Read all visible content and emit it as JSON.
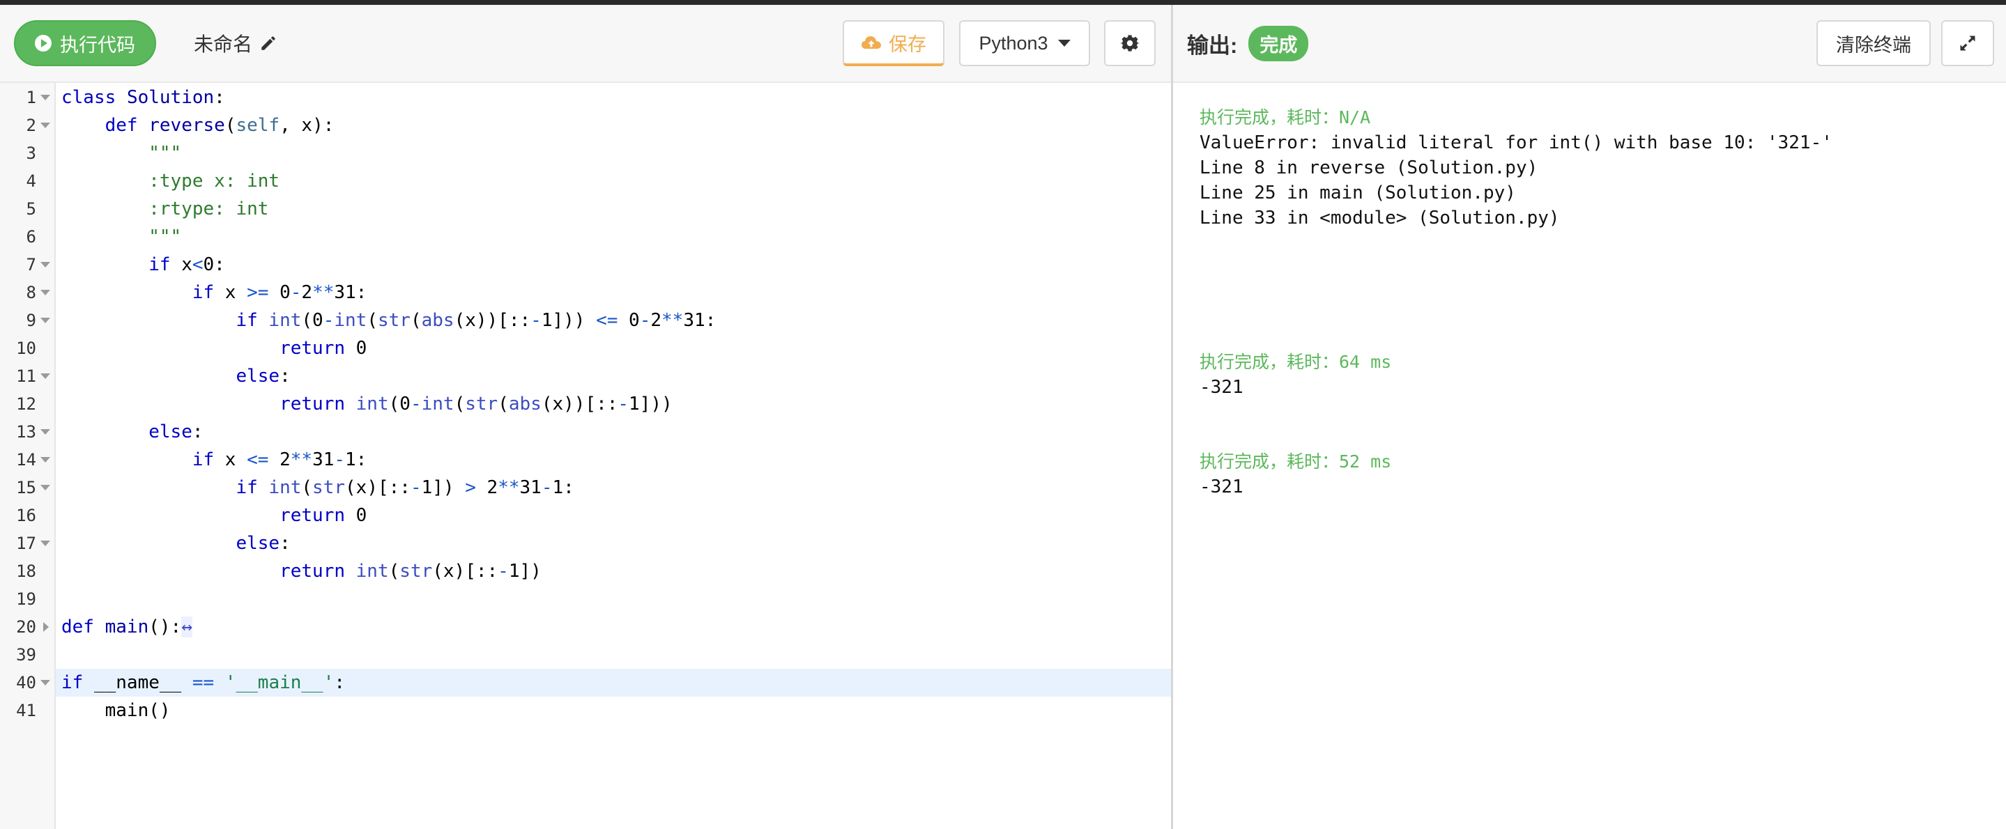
{
  "header": {
    "run_label": "执行代码",
    "file_name": "未命名",
    "save_label": "保存",
    "language": "Python3"
  },
  "editor": {
    "lines": [
      {
        "n": "1",
        "fold": "open",
        "code": "class Solution:"
      },
      {
        "n": "2",
        "fold": "open",
        "code": "    def reverse(self, x):"
      },
      {
        "n": "3",
        "fold": "",
        "code": "        \"\"\""
      },
      {
        "n": "4",
        "fold": "",
        "code": "        :type x: int"
      },
      {
        "n": "5",
        "fold": "",
        "code": "        :rtype: int"
      },
      {
        "n": "6",
        "fold": "",
        "code": "        \"\"\""
      },
      {
        "n": "7",
        "fold": "open",
        "code": "        if x<0:"
      },
      {
        "n": "8",
        "fold": "open",
        "code": "            if x >= 0-2**31:"
      },
      {
        "n": "9",
        "fold": "open",
        "code": "                if int(0-int(str(abs(x))[::-1])) <= 0-2**31:"
      },
      {
        "n": "10",
        "fold": "",
        "code": "                    return 0"
      },
      {
        "n": "11",
        "fold": "open",
        "code": "                else:"
      },
      {
        "n": "12",
        "fold": "",
        "code": "                    return int(0-int(str(abs(x))[::-1]))"
      },
      {
        "n": "13",
        "fold": "open",
        "code": "        else:"
      },
      {
        "n": "14",
        "fold": "open",
        "code": "            if x <= 2**31-1:"
      },
      {
        "n": "15",
        "fold": "open",
        "code": "                if int(str(x)[::-1]) > 2**31-1:"
      },
      {
        "n": "16",
        "fold": "",
        "code": "                    return 0"
      },
      {
        "n": "17",
        "fold": "open",
        "code": "                else:"
      },
      {
        "n": "18",
        "fold": "",
        "code": "                    return int(str(x)[::-1])"
      },
      {
        "n": "19",
        "fold": "",
        "code": ""
      },
      {
        "n": "20",
        "fold": "closed",
        "code": "def main():"
      },
      {
        "n": "39",
        "fold": "",
        "code": ""
      },
      {
        "n": "40",
        "fold": "open",
        "code": "if __name__ == '__main__':",
        "active": true
      },
      {
        "n": "41",
        "fold": "",
        "code": "    main()"
      }
    ],
    "folded_marker": "↔"
  },
  "output": {
    "title": "输出:",
    "status": "完成",
    "clear_label": "清除终端",
    "blocks": [
      {
        "status": "执行完成，耗时：N/A",
        "lines": [
          "ValueError: invalid literal for int() with base 10: '321-'",
          "Line 8 in reverse (Solution.py)",
          "Line 25 in main (Solution.py)",
          "Line 33 in <module> (Solution.py)"
        ]
      },
      {
        "status": "执行完成，耗时：64 ms",
        "lines": [
          "-321"
        ]
      },
      {
        "status": "执行完成，耗时：52 ms",
        "lines": [
          "-321"
        ]
      }
    ]
  },
  "colors": {
    "run_green": "#5cb85c",
    "save_orange": "#f0ad4e",
    "active_line": "#e8f2fe"
  }
}
